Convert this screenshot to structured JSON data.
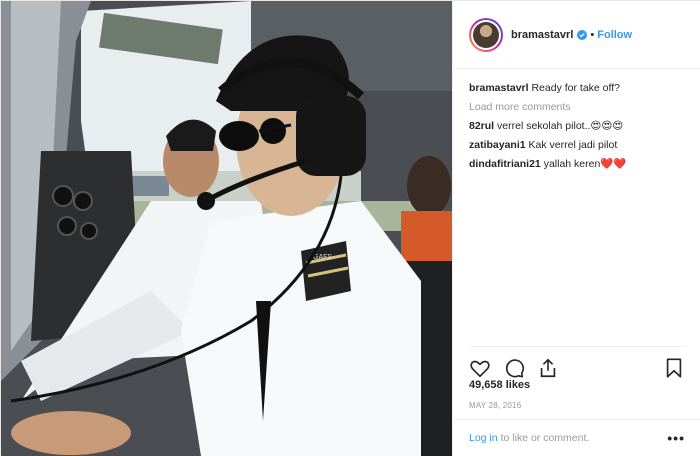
{
  "post": {
    "username": "bramastavrl",
    "follow_label": "Follow",
    "separator": "•",
    "caption_user": "bramastavrl",
    "caption_text": "Ready for take off?",
    "load_more": "Load more comments",
    "comments": [
      {
        "user": "82rul",
        "text": "verrel sekolah pilot..😍😍😍"
      },
      {
        "user": "zatibayani1",
        "text": "Kak verrel jadi pilot"
      },
      {
        "user": "dindafitriani21",
        "text": "yallah keren❤️❤️"
      }
    ],
    "likes": "49,658 likes",
    "date": "MAY 28, 2016",
    "login_link": "Log in",
    "login_rest": "to like or comment.",
    "more": "•••"
  },
  "photo": {
    "epaulette_text": "GAFS"
  },
  "colors": {
    "accent": "#3897f0",
    "text": "#262626",
    "muted": "#999999"
  },
  "icons": [
    "heart-icon",
    "comment-icon",
    "share-icon",
    "bookmark-icon",
    "verified-icon",
    "more-icon"
  ]
}
